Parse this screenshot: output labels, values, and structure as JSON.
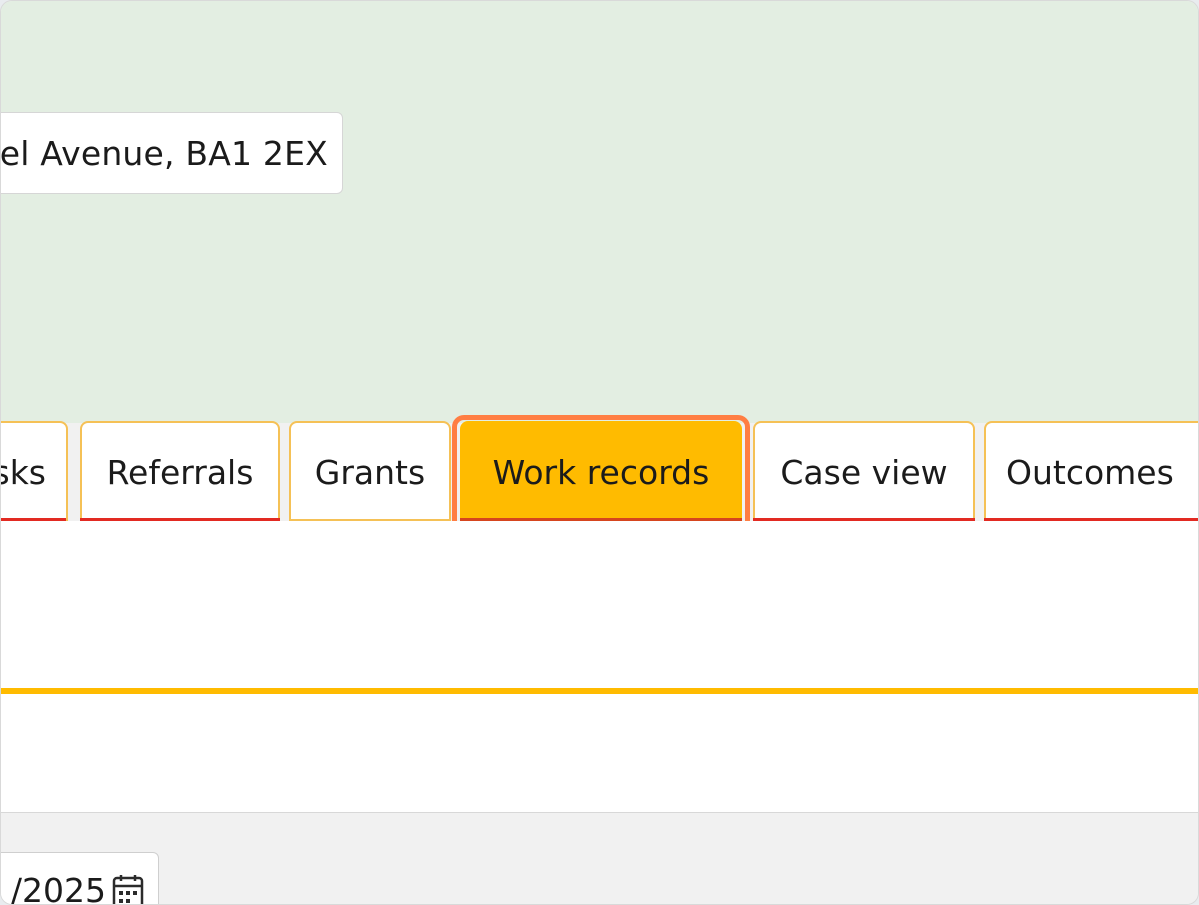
{
  "header": {
    "address": "el Avenue, BA1 2EX"
  },
  "tabs": [
    {
      "id": "tasks",
      "label": "sks",
      "active": false
    },
    {
      "id": "referrals",
      "label": "Referrals",
      "active": false
    },
    {
      "id": "grants",
      "label": "Grants",
      "active": false
    },
    {
      "id": "work_records",
      "label": "Work records",
      "active": true
    },
    {
      "id": "case_view",
      "label": "Case view",
      "active": false
    },
    {
      "id": "outcomes",
      "label": "Outcomes",
      "active": false
    }
  ],
  "date_field": {
    "value": "/2025",
    "icon": "calendar-icon"
  },
  "colors": {
    "header_bg": "#e3eee2",
    "accent": "#ffbb00",
    "focus_ring": "#ff7e43",
    "tab_underline": "#e22a22"
  }
}
